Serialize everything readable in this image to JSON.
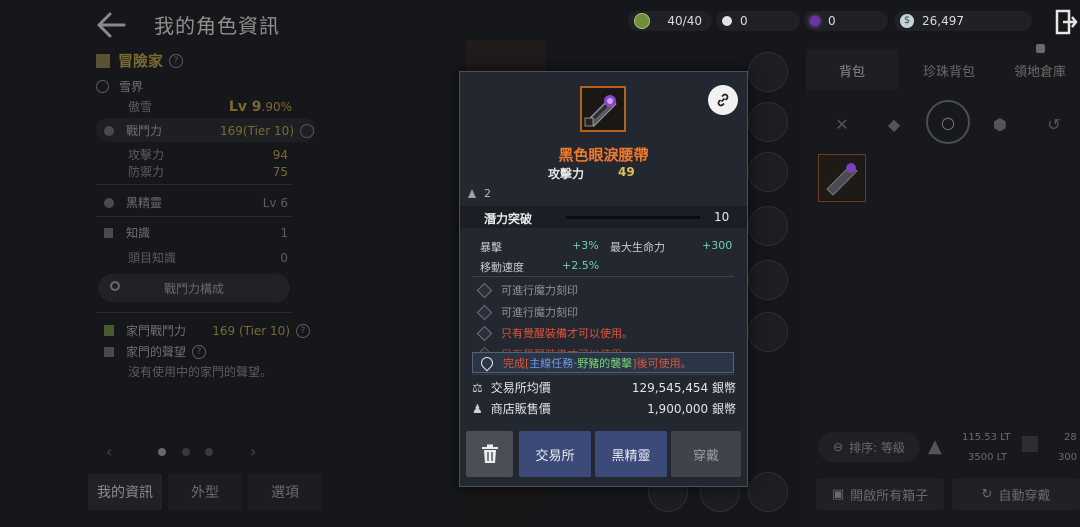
{
  "header": {
    "title": "我的角色資訊",
    "resources": [
      {
        "name": "stamina",
        "value": "40/40",
        "icon": "leaf-token-icon",
        "color": "#7da24a"
      },
      {
        "name": "pearl",
        "value": "0",
        "icon": "white-pearl-icon",
        "color": "#e8e8e8"
      },
      {
        "name": "black-pearl",
        "value": "0",
        "icon": "purple-pearl-icon",
        "color": "#7c3fb5"
      },
      {
        "name": "silver",
        "value": "26,497",
        "icon": "silver-coin-icon",
        "color": "#b9c3cc"
      }
    ]
  },
  "left_panel": {
    "class_name": "冒險家",
    "region": "雪界",
    "char_name": "傲雪",
    "level": "Lv 9",
    "level_pct": ".90%",
    "combat_power_label": "戰鬥力",
    "combat_power_value": "169(Tier 10)",
    "attack_label": "攻擊力",
    "attack_value": "94",
    "defense_label": "防禦力",
    "defense_value": "75",
    "black_spirit_label": "黑精靈",
    "black_spirit_value": "Lv 6",
    "knowledge_label": "知識",
    "knowledge_value": "1",
    "boss_knowledge_label": "頭目知識",
    "boss_knowledge_value": "0",
    "cp_breakdown_button": "戰鬥力構成",
    "family_cp_label": "家門戰鬥力",
    "family_cp_value": "169 (Tier 10)",
    "family_fame_label": "家門的聲望",
    "family_fame_text": "沒有使用中的家門的聲望。",
    "bottom_tabs": [
      "我的資訊",
      "外型",
      "選項"
    ]
  },
  "right_panel": {
    "tabs": [
      "背包",
      "珍珠背包",
      "領地倉庫"
    ],
    "sort_label": "排序: 等級",
    "weight_current": "115.53 LT",
    "weight_max": "3500 LT",
    "slots_partial_1": "28",
    "slots_partial_2": "300",
    "open_boxes_button": "開啟所有箱子",
    "auto_equip_button": "自動穿戴"
  },
  "popup": {
    "item_name": "黑色眼淚腰帶",
    "stat_main_label": "攻擊力",
    "stat_main_value": "49",
    "owner_count": "2",
    "potential_label": "潛力突破",
    "potential_value": "10",
    "stats": [
      {
        "label": "暴擊",
        "value": "+3%"
      },
      {
        "label": "最大生命力",
        "value": "+300"
      },
      {
        "label": "移動速度",
        "value": "+2.5%"
      }
    ],
    "engrave_slots": [
      "可進行魔力刻印",
      "可進行魔力刻印"
    ],
    "requirement_text": "只有覺醒裝備才可以使用。",
    "requirement_text_obscured": "只有覺醒裝備才可以使用。",
    "quest_notice": {
      "prefix": "完成[",
      "quest_type": "主線任務",
      "separator": " - ",
      "quest_name": "野豬的襲擊",
      "suffix": "]後可使用。"
    },
    "market_label": "交易所均價",
    "market_value": "129,545,454 銀幣",
    "shop_label": "商店販售價",
    "shop_value": "1,900,000 銀幣",
    "buttons": {
      "market": "交易所",
      "black_spirit": "黑精靈",
      "equip": "穿戴"
    }
  },
  "colors": {
    "item_name": "#f07a2a",
    "stat_green": "#6fd1a8",
    "requirement_red": "#e0553d",
    "quest_blue": "#6f9ce8",
    "quest_green": "#7cd37a",
    "button_blue": "#3b4a78"
  }
}
